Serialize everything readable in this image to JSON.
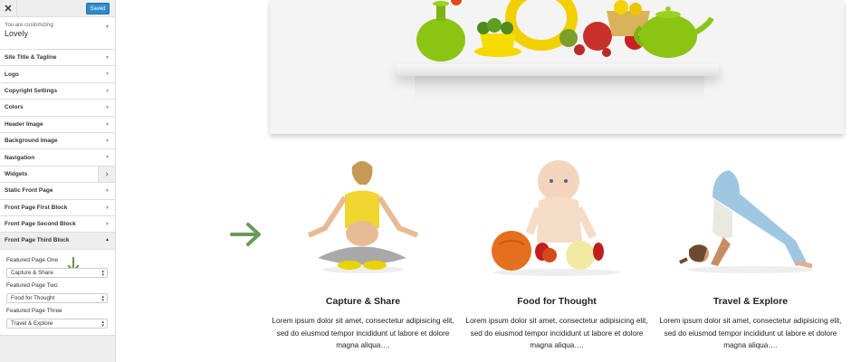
{
  "sidebar": {
    "close_icon": "✕",
    "saved_label": "Saved",
    "customizing_label": "You are customizing",
    "theme_name": "Lovely",
    "sections": [
      {
        "label": "Site Title & Tagline"
      },
      {
        "label": "Logo"
      },
      {
        "label": "Copyright Settings"
      },
      {
        "label": "Colors"
      },
      {
        "label": "Header Image"
      },
      {
        "label": "Background Image"
      },
      {
        "label": "Navigation"
      },
      {
        "label": "Widgets"
      },
      {
        "label": "Static Front Page"
      },
      {
        "label": "Front Page First Block"
      },
      {
        "label": "Front Page Second Block"
      },
      {
        "label": "Front Page Third Block"
      }
    ],
    "third_block": {
      "fields": [
        {
          "label": "Featured Page One",
          "value": "Capture & Share"
        },
        {
          "label": "Featured Page Two",
          "value": "Food for Thought"
        },
        {
          "label": "Featured Page Three",
          "value": "Travel & Explore"
        }
      ]
    }
  },
  "preview": {
    "columns": [
      {
        "title": "Capture & Share",
        "text": "Lorem ipsum dolor sit amet, consectetur adipisicing elit, sed do eiusmod tempor incididunt ut labore et dolore magna aliqua…."
      },
      {
        "title": "Food for Thought",
        "text": "Lorem ipsum dolor sit amet, consectetur adipisicing elit, sed do eiusmod tempor incididunt ut labore et dolore magna aliqua…."
      },
      {
        "title": "Travel & Explore",
        "text": "Lorem ipsum dolor sit amet, consectetur adipisicing elit, sed do eiusmod tempor incididunt ut labore et dolore magna aliqua…."
      }
    ]
  },
  "colors": {
    "accent": "#2e8bcc",
    "arrow": "#6a9a5a"
  }
}
